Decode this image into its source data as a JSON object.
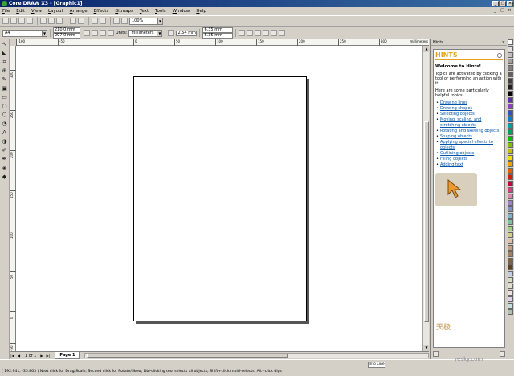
{
  "window": {
    "title": "CorelDRAW X3 - [Graphic1]",
    "buttons": [
      "_",
      "□",
      "×"
    ]
  },
  "menu": [
    "File",
    "Edit",
    "View",
    "Layout",
    "Arrange",
    "Effects",
    "Bitmaps",
    "Text",
    "Tools",
    "Window",
    "Help"
  ],
  "mdi_buttons": [
    "_",
    "□",
    "×"
  ],
  "standard_toolbar": {
    "zoom": "100%"
  },
  "property_bar": {
    "paper_size": "A4",
    "width": "210.0 mm",
    "height": "297.0 mm",
    "units_label": "Units:",
    "units_value": "millimeters",
    "nudge": "2.54 mm",
    "dup_x": "6.35 mm",
    "dup_y": "6.35 mm"
  },
  "ruler": {
    "h_ticks": [
      "-100",
      "-50",
      "0",
      "50",
      "100",
      "150",
      "200",
      "250",
      "300"
    ],
    "unit": "millimeters",
    "v_ticks": [
      "300",
      "250",
      "200",
      "150",
      "100",
      "50",
      "0",
      "-50"
    ]
  },
  "toolbox_icons": [
    "pick-tool",
    "shape-tool",
    "crop-tool",
    "zoom-tool",
    "freehand-tool",
    "smart-fill-tool",
    "rectangle-tool",
    "ellipse-tool",
    "polygon-tool",
    "basic-shapes-tool",
    "text-tool",
    "interactive-blend-tool",
    "eyedropper-tool",
    "outline-tool",
    "fill-tool",
    "interactive-fill-tool"
  ],
  "page_nav": {
    "count": "1 of 1",
    "tab": "Page 1"
  },
  "hints": {
    "docker_label": "Hints",
    "title": "HINTS",
    "welcome": "Welcome to Hints!",
    "intro": "Topics are activated by clicking a tool or performing an action with it.",
    "helpful": "Here are some particularly helpful topics:",
    "topics": [
      "Drawing lines",
      "Drawing shapes",
      "Selecting objects",
      "Moving, scaling, and stretching objects",
      "Rotating and skewing objects",
      "Shaping objects",
      "Applying special effects to objects",
      "Outlining objects",
      "Filling objects",
      "Adding text"
    ]
  },
  "palette": [
    "#ffffff",
    "#e0e0e0",
    "#c0c0c0",
    "#a0a0a0",
    "#808080",
    "#606060",
    "#404040",
    "#202020",
    "#000000",
    "#6030a0",
    "#9040c0",
    "#3050c0",
    "#0080d0",
    "#00a0a0",
    "#00a060",
    "#00c000",
    "#80c000",
    "#c0c000",
    "#f0e000",
    "#f0a000",
    "#e06000",
    "#d02000",
    "#c00040",
    "#d04080",
    "#e080b0",
    "#a080c0",
    "#8090c0",
    "#80b0d0",
    "#80c0a0",
    "#a0d080",
    "#d0d080",
    "#e0c0a0",
    "#c0a080",
    "#a08060",
    "#806040",
    "#604020",
    "#c0d0e0",
    "#d0e0c0",
    "#e0e0d0",
    "#f0e0e0",
    "#e0d0f0",
    "#c0e0e0",
    "#b0c0b0"
  ],
  "status": {
    "info_line": "Info Line",
    "text": "( 192.941; -35.863 )       Next click for Drag/Scale; Second click for Rotate/Skew; Dbl-clicking tool selects all objects; Shift+click multi-selects; Alt+click digs"
  },
  "watermark": {
    "brand": "天极",
    "url": "yesky.com"
  }
}
